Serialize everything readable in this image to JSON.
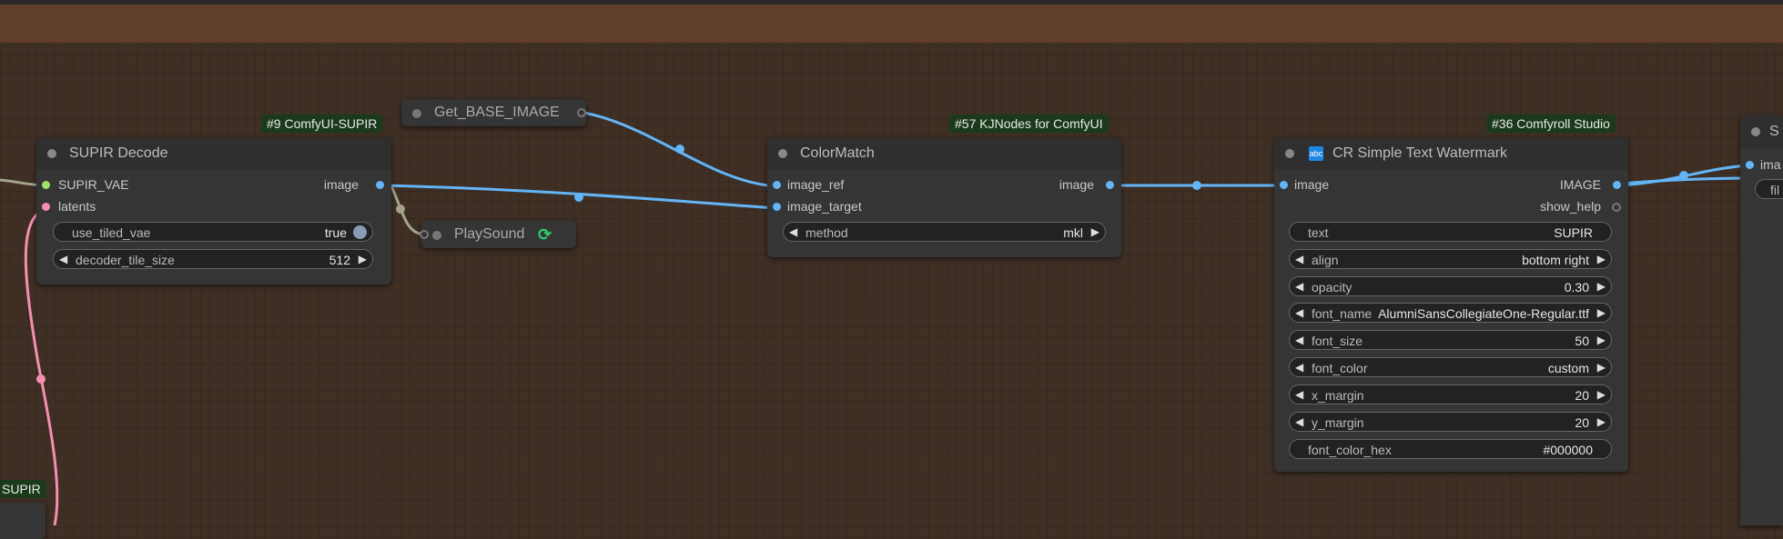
{
  "canvas": {
    "bg_color": "#3f2f25",
    "group_band_color": "#613f2b",
    "wire_colors": {
      "image": "#64b5f6",
      "latent": "#f48fb1",
      "misc": "#a3a48a"
    }
  },
  "badges": {
    "supir_decode": "#9 ComfyUI-SUPIR",
    "colormatch": "#57 KJNodes for ComfyUI",
    "watermark": "#36 Comfyroll Studio",
    "bottom_left": "SUPIR"
  },
  "supir_decode": {
    "title": "SUPIR Decode",
    "inputs": [
      "SUPIR_VAE",
      "latents"
    ],
    "output": "image",
    "widgets": {
      "use_tiled_vae": {
        "label": "use_tiled_vae",
        "value": "true"
      },
      "decoder_tile_size": {
        "label": "decoder_tile_size",
        "value": "512"
      }
    }
  },
  "get_base_image": {
    "title": "Get_BASE_IMAGE"
  },
  "playsound": {
    "title": "PlaySound",
    "icon": "refresh-icon"
  },
  "colormatch": {
    "title": "ColorMatch",
    "inputs": [
      "image_ref",
      "image_target"
    ],
    "output": "image",
    "widgets": {
      "method": {
        "label": "method",
        "value": "mkl"
      }
    }
  },
  "watermark": {
    "title": "CR Simple Text Watermark",
    "icon_text": "abc",
    "input": "image",
    "outputs": [
      "IMAGE",
      "show_help"
    ],
    "widgets": [
      {
        "label": "text",
        "value": "SUPIR"
      },
      {
        "label": "align",
        "value": "bottom right"
      },
      {
        "label": "opacity",
        "value": "0.30"
      },
      {
        "label": "font_name",
        "value": "AlumniSansCollegiateOne-Regular.ttf"
      },
      {
        "label": "font_size",
        "value": "50"
      },
      {
        "label": "font_color",
        "value": "custom"
      },
      {
        "label": "x_margin",
        "value": "20"
      },
      {
        "label": "y_margin",
        "value": "20"
      },
      {
        "label": "font_color_hex",
        "value": "#000000"
      }
    ]
  },
  "right_edge": {
    "title": "S",
    "input": "ima",
    "widget": "fil"
  }
}
